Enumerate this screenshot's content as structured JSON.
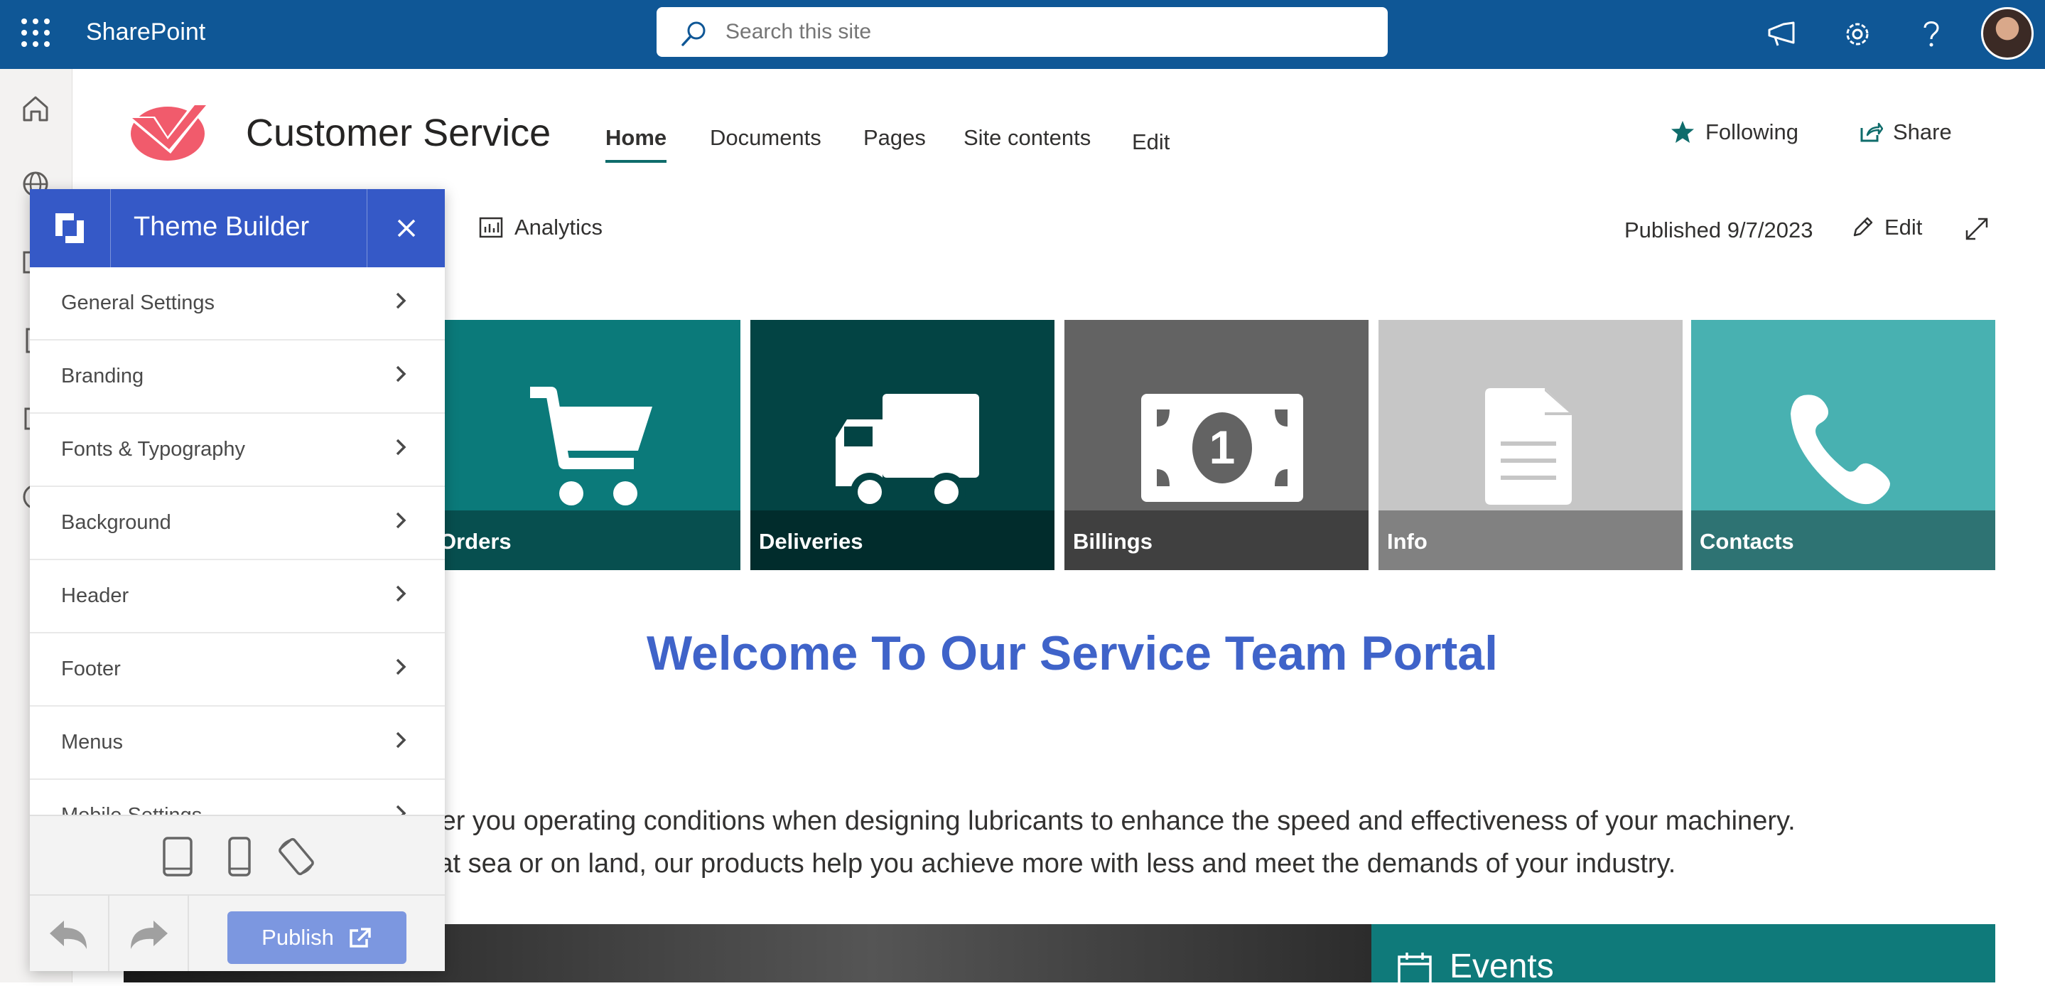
{
  "suitebar": {
    "brand": "SharePoint",
    "search_placeholder": "Search this site",
    "bg_color": "#0f5796",
    "icons": [
      "waffle-icon",
      "megaphone-icon",
      "gear-icon",
      "help-icon",
      "avatar"
    ]
  },
  "site": {
    "title": "Customer Service",
    "nav": [
      "Home",
      "Documents",
      "Pages",
      "Site contents",
      "Edit"
    ],
    "following_label": "Following",
    "share_label": "Share"
  },
  "commandbar": {
    "analytics_label": "Analytics",
    "published_text": "Published 9/7/2023",
    "edit_label": "Edit"
  },
  "tiles": [
    {
      "label": "Orders",
      "color": "#0b7a7a",
      "icon": "cart-icon"
    },
    {
      "label": "Deliveries",
      "color": "#034444",
      "icon": "truck-icon"
    },
    {
      "label": "Billings",
      "color": "#636363",
      "icon": "money-icon"
    },
    {
      "label": "Info",
      "color": "#c6c6c6",
      "icon": "document-icon"
    },
    {
      "label": "Contacts",
      "color": "#48b1b1",
      "icon": "phone-icon"
    }
  ],
  "content": {
    "welcome": "Welcome To Our Service Team Portal",
    "para_line1": "sider you operating conditions when designing lubricants to enhance the speed and effectiveness of your machinery.",
    "para_line2": "er at sea or on land, our products help you achieve more with less and meet the demands of your industry.",
    "events_title": "Events",
    "accent_color": "#3f63c9"
  },
  "theme_builder": {
    "title": "Theme Builder",
    "items": [
      "General Settings",
      "Branding",
      "Fonts & Typography",
      "Background",
      "Header",
      "Footer",
      "Menus",
      "Mobile Settings"
    ],
    "publish_label": "Publish",
    "header_color": "#3559c7"
  }
}
